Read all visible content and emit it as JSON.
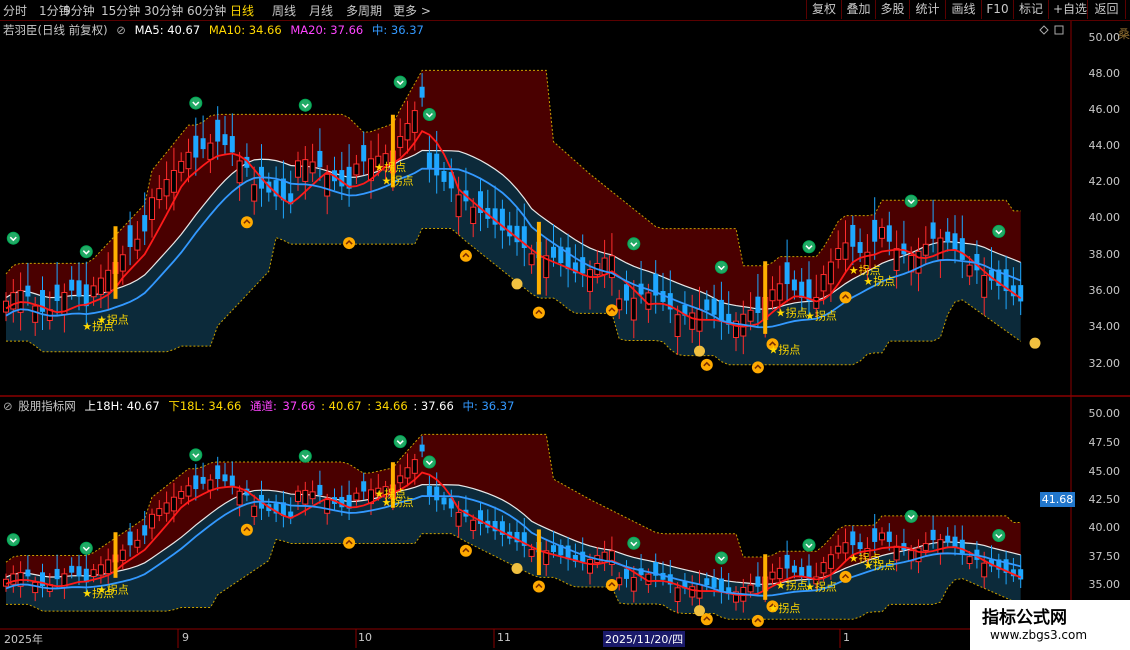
{
  "toolbar": {
    "left": [
      "分时",
      "1分钟",
      "5分钟",
      "15分钟",
      "30分钟",
      "60分钟",
      "日线",
      "周线",
      "月线",
      "多周期",
      "更多 >"
    ],
    "active": "日线",
    "right": [
      "复权",
      "叠加",
      "多股",
      "统计",
      "画线",
      "F10",
      "标记",
      "+自选",
      "返回"
    ]
  },
  "panel1": {
    "title": "若羽臣(日线 前复权)",
    "ma5": "MA5: 40.67",
    "ma10": "MA10: 34.66",
    "ma20": "MA20: 37.66",
    "mid": "中: 36.37",
    "yticks": [
      "50.00",
      "48.00",
      "46.00",
      "44.00",
      "42.00",
      "40.00",
      "38.00",
      "36.00",
      "34.00",
      "32.00"
    ]
  },
  "panel2": {
    "title": "股朋指标网",
    "up": "上18H: 40.67",
    "down": "下18L: 34.66",
    "channel_label": "通道:",
    "ch1": "37.66",
    "ch2": ": 40.67",
    "ch3": ": 34.66",
    "ch4": ": 37.66",
    "mid": "中: 36.37",
    "yticks": [
      "50.00",
      "47.50",
      "45.00",
      "42.50",
      "40.00",
      "37.50",
      "35.00"
    ],
    "price_box": "41.68"
  },
  "xaxis": {
    "labels": [
      "2025年",
      "9",
      "10",
      "11",
      "2025/11/20/四",
      "1"
    ]
  },
  "marker_text": "拐点",
  "side_text_right": "桑",
  "watermark": {
    "line1": "指标公式网",
    "line2": "www.zbgs3.com"
  },
  "colors": {
    "up": "#ff2d2d",
    "down": "#1ea7ff",
    "ma_red": "#ff1a1a",
    "ma_blue": "#3399ff",
    "band_red": "#4a0000",
    "band_blue": "#0c2a3a",
    "yellow": "#ffd800",
    "magenta": "#ff44ff"
  }
}
